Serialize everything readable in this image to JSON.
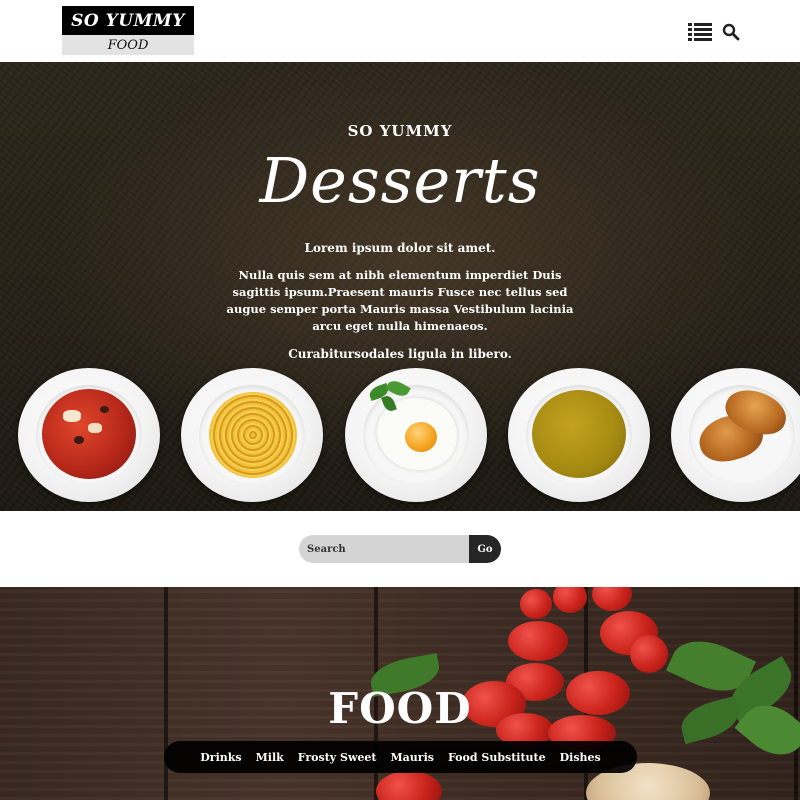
{
  "header": {
    "logo_top": "SO YUMMY",
    "logo_bottom": "FOOD",
    "menu_icon": "list-menu-icon",
    "search_icon": "search-icon"
  },
  "hero": {
    "kicker": "SO YUMMY",
    "title": "Desserts",
    "lead": "Lorem ipsum dolor sit amet.",
    "body": "Nulla quis sem at nibh elementum imperdiet Duis sagittis ipsum.Praesent mauris Fusce nec tellus sed augue semper porta Mauris massa Vestibulum lacinia arcu eget nulla himenaeos.",
    "foot": "Curabitursodales ligula in libero.",
    "plates": [
      "tomato-soup",
      "spaghetti",
      "fried-egg",
      "pea-soup",
      "croissants"
    ]
  },
  "search": {
    "placeholder": "Search",
    "go_label": "Go"
  },
  "food_section": {
    "title": "FOOD",
    "nav": [
      "Drinks",
      "Milk",
      "Frosty Sweet",
      "Mauris",
      "Food Substitute",
      "Dishes"
    ]
  },
  "colors": {
    "header_bg": "#ffffff",
    "logo_dark": "#000000",
    "logo_light": "#e3e3e3",
    "hero_bg": "#2a2318",
    "search_field": "#d4d4d4",
    "go_button": "#262626",
    "nav_bar": "#000000",
    "wood": "#45322a"
  }
}
